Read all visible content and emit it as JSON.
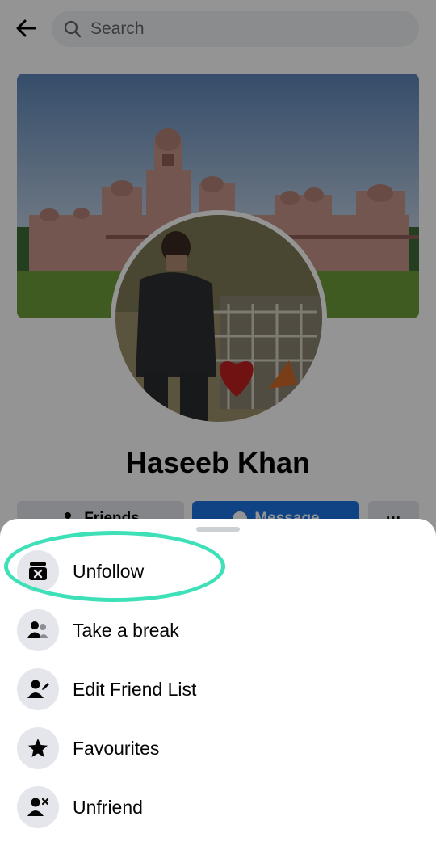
{
  "header": {
    "back_icon": "arrow-left-icon",
    "search_placeholder": "Search",
    "search_icon": "search-icon"
  },
  "profile": {
    "name": "Haseeb Khan",
    "actions": {
      "friends_label": "Friends",
      "message_label": "Message",
      "more_label": "···"
    }
  },
  "sheet": {
    "items": [
      {
        "label": "Unfollow",
        "icon": "unfollow-icon"
      },
      {
        "label": "Take a break",
        "icon": "take-a-break-icon"
      },
      {
        "label": "Edit Friend List",
        "icon": "edit-friend-list-icon"
      },
      {
        "label": "Favourites",
        "icon": "star-icon"
      },
      {
        "label": "Unfriend",
        "icon": "unfriend-icon"
      }
    ]
  },
  "colors": {
    "accent_blue": "#1b74e4",
    "highlight_ring": "#3ee0b8",
    "icon_circle": "#e4e6eb",
    "text": "#050505"
  }
}
